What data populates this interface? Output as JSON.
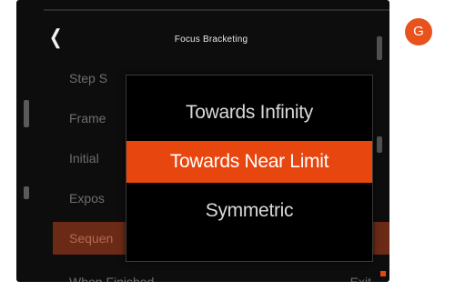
{
  "header": {
    "back_icon": "chevron-left-icon",
    "title": "Focus Bracketing"
  },
  "menu": {
    "items": [
      {
        "label": "Step S",
        "value": ""
      },
      {
        "label": "Frame",
        "value": ""
      },
      {
        "label": "Initial",
        "value": ""
      },
      {
        "label": "Expos",
        "value": ""
      },
      {
        "label": "Sequen",
        "value": ""
      },
      {
        "label": "When Finished",
        "value": "Exit"
      }
    ],
    "selected_index": 4
  },
  "popup": {
    "options": [
      "Towards Infinity",
      "Towards Near Limit",
      "Symmetric"
    ],
    "selected_index": 1
  },
  "badge": {
    "letter": "G"
  },
  "colors": {
    "accent": "#e8460f",
    "badge": "#e8521c",
    "background": "#0d0d0d"
  }
}
